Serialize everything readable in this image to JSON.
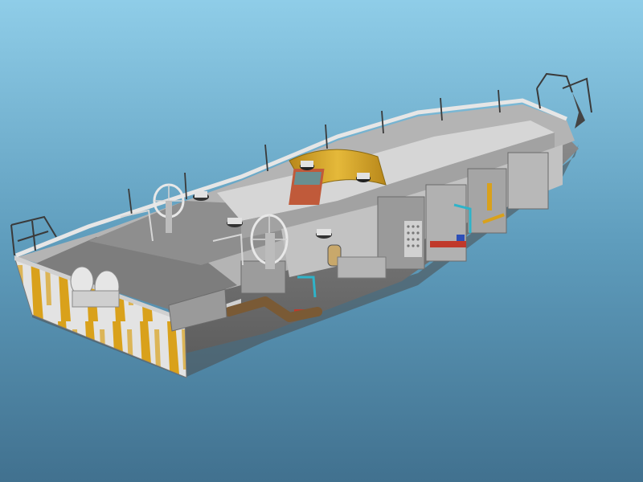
{
  "scene": {
    "description_for_agent": "",
    "colors": {
      "background_top": "#8fcde8",
      "background_mid": "#5f9dbd",
      "background_bottom": "#41718f",
      "hull_light": "#c9c9c9",
      "hull_mid": "#9b9b9b",
      "hull_dark": "#6c6c6c",
      "deck": "#a8a8a8",
      "transom_yellow": "#d9a11b",
      "canopy_yellow": "#d9a826",
      "pipe_brown": "#7a5a35",
      "accent_red": "#c0392b",
      "accent_cyan": "#2fb3c9",
      "accent_blue": "#2d4fb8"
    }
  }
}
